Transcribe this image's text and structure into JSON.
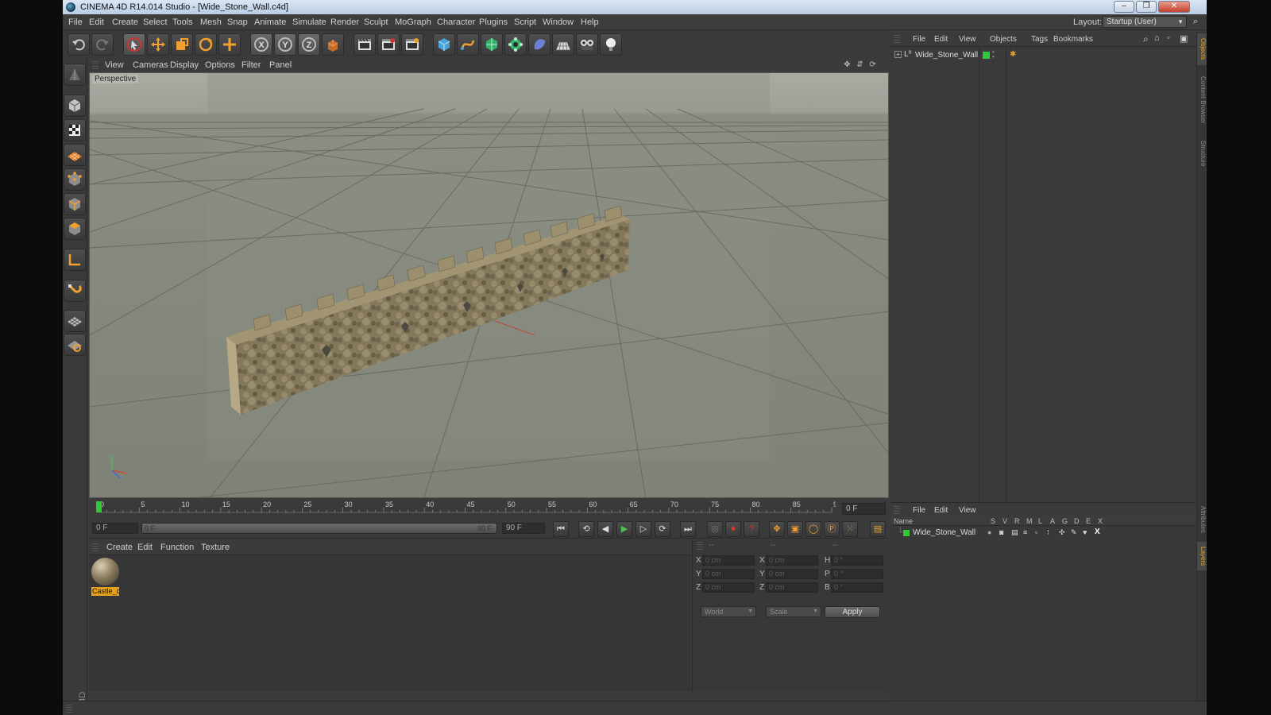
{
  "window": {
    "title": "CINEMA 4D R14.014 Studio - [Wide_Stone_Wall.c4d]",
    "controls": [
      "‒",
      "❐",
      "✕"
    ]
  },
  "menubar": {
    "items": [
      "File",
      "Edit",
      "Create",
      "Select",
      "Tools",
      "Mesh",
      "Snap",
      "Animate",
      "Simulate",
      "Render",
      "Sculpt",
      "MoGraph",
      "Character",
      "Plugins",
      "Script",
      "Window",
      "Help"
    ],
    "layout_label": "Layout:",
    "layout_value": "Startup (User)"
  },
  "toolbar": {
    "icons": [
      "undo-icon",
      "redo-icon",
      "live-selection-icon",
      "move-icon",
      "scale-icon",
      "rotate-icon",
      "recent-tool-icon",
      "x-axis-lock-icon",
      "y-axis-lock-icon",
      "z-axis-lock-icon",
      "world-coordinates-icon",
      "render-view-icon",
      "render-picture-viewer-icon",
      "render-settings-icon",
      "cube-object-icon",
      "spline-pen-icon",
      "subdivision-surface-icon",
      "array-generator-icon",
      "deformer-icon",
      "floor-environment-icon",
      "camera-icon",
      "light-icon"
    ]
  },
  "left_tools": {
    "icons": [
      "make-editable-icon",
      "model-mode-icon",
      "texture-mode-icon",
      "workplane-mode-icon",
      "points-mode-icon",
      "edges-mode-icon",
      "polygons-mode-icon",
      "axis-mode-icon",
      "tweak-magnet-icon",
      "workplane-grid-icon",
      "locked-workplane-icon"
    ],
    "logo_text": "MAXON CINEMA 4D"
  },
  "viewport": {
    "menu": [
      "View",
      "Cameras",
      "Display",
      "Options",
      "Filter",
      "Panel"
    ],
    "label": "Perspective",
    "nav_icons": [
      "✥",
      "⇵",
      "⟳",
      "▭"
    ],
    "colors": {
      "background": "#8c8f84",
      "horizon": "#a6a89e",
      "grid_line": "#5f6158",
      "wall_light": "#9a8c6c",
      "wall_dark": "#6e644c"
    }
  },
  "timeline": {
    "ticks": [
      0,
      5,
      10,
      15,
      20,
      25,
      30,
      35,
      40,
      45,
      50,
      55,
      60,
      65,
      70,
      75,
      80,
      85,
      90
    ],
    "current_frame": "0 F",
    "max_frame": 90
  },
  "transport": {
    "start_field": "0 F",
    "range_start": "0 F",
    "range_end": "90 F",
    "end_field": "90 F",
    "buttons": [
      "⏮",
      "⟲",
      "◀",
      "▶",
      "▷",
      "⟳",
      "⏭"
    ]
  },
  "material_manager": {
    "menu": [
      "Create",
      "Edit",
      "Function",
      "Texture"
    ],
    "material_name": "Castle_c"
  },
  "coordinates": {
    "headers": [
      "--",
      "--",
      "--"
    ],
    "rows": [
      {
        "a": "X",
        "v1": "0 cm",
        "b": "X",
        "v2": "0 cm",
        "c": "H",
        "v3": "0 °"
      },
      {
        "a": "Y",
        "v1": "0 cm",
        "b": "Y",
        "v2": "0 cm",
        "c": "P",
        "v3": "0 °"
      },
      {
        "a": "Z",
        "v1": "0 cm",
        "b": "Z",
        "v2": "0 cm",
        "c": "B",
        "v3": "0 °"
      }
    ],
    "mode_select": "World",
    "size_select": "Scale",
    "apply_label": "Apply"
  },
  "object_manager": {
    "menu": [
      "File",
      "Edit",
      "View",
      "Objects",
      "Tags",
      "Bookmarks"
    ],
    "objects": [
      {
        "name": "Wide_Stone_Wall"
      }
    ]
  },
  "layer_manager": {
    "menu": [
      "File",
      "Edit",
      "View"
    ],
    "columns": [
      "Name",
      "S",
      "V",
      "R",
      "M",
      "L",
      "A",
      "G",
      "D",
      "E",
      "X"
    ],
    "rows": [
      {
        "name": "Wide_Stone_Wall"
      }
    ]
  },
  "side_tabs": [
    "Objects",
    "Content Browser",
    "Structure",
    "Attributes",
    "Layers"
  ]
}
